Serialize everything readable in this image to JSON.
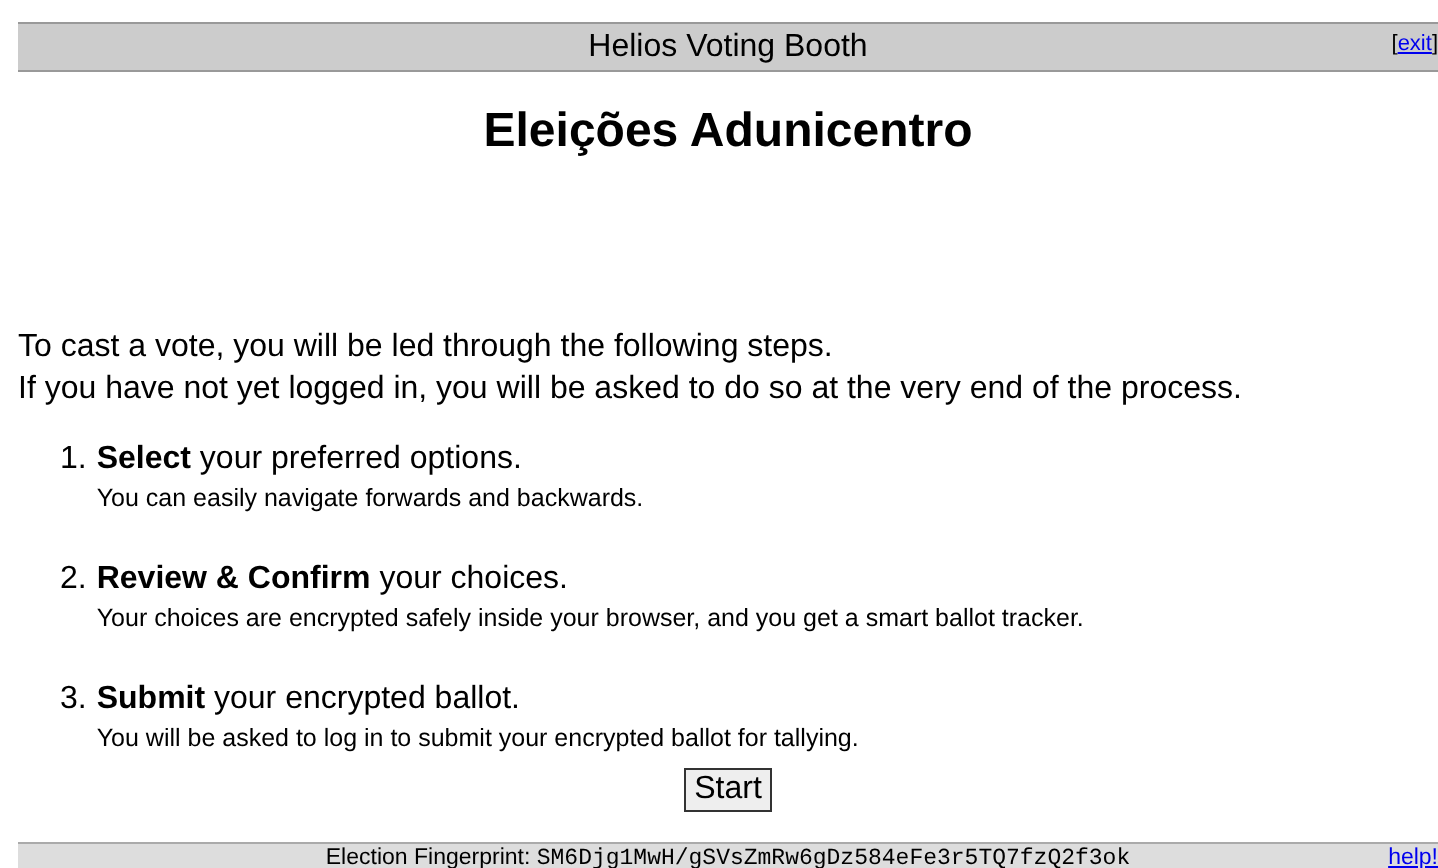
{
  "header": {
    "title": "Helios Voting Booth",
    "open_bracket": "[",
    "exit_link": "exit",
    "close_bracket": "]"
  },
  "election_title": "Eleições Adunicentro",
  "intro": [
    "To cast a vote, you will be led through the following steps.",
    "If you have not yet logged in, you will be asked to do so at the very end of the process."
  ],
  "steps": [
    {
      "number": "1.",
      "title": "Select",
      "rest": " your preferred options.",
      "description": "You can easily navigate forwards and backwards."
    },
    {
      "number": "2.",
      "title": "Review & Confirm",
      "rest": " your choices.",
      "description": "Your choices are encrypted safely inside your browser, and you get a smart ballot tracker."
    },
    {
      "number": "3.",
      "title": "Submit",
      "rest": " your encrypted ballot.",
      "description": "You will be asked to log in to submit your encrypted ballot for tallying."
    }
  ],
  "start_button": "Start",
  "footer": {
    "label": "Election Fingerprint:",
    "fingerprint": "SM6Djg1MwH/gSVsZmRw6gDz584eFe3r5TQ7fzQ2f3ok",
    "help_link": "help!"
  }
}
